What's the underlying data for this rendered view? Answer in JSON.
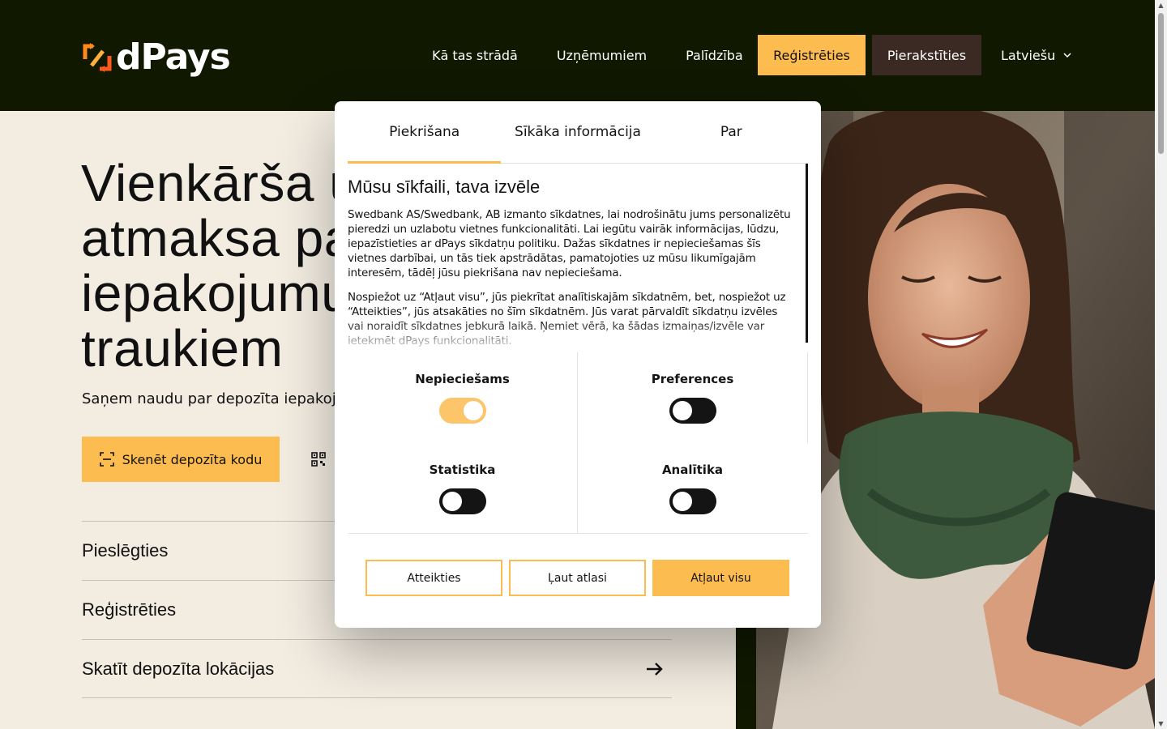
{
  "header": {
    "logo_text": "dPays",
    "nav": [
      "Kā tas strādā",
      "Uzņēmumiem",
      "Palīdzība"
    ],
    "register_label": "Reģistrēties",
    "login_label": "Pierakstīties",
    "language": "Latviešu"
  },
  "hero": {
    "title": "Vienkārša u\natmaksa pa\niepakojumu\ntraukiem",
    "subtitle": "Saņem naudu par depozīta iepakoju",
    "scan_button": "Skenēt depozīta kodu",
    "links": [
      "Pieslēgties",
      "Reģistrēties",
      "Skatīt depozīta lokācijas"
    ]
  },
  "modal": {
    "tabs": [
      "Piekrišana",
      "Sīkāka informācija",
      "Par"
    ],
    "active_tab": 0,
    "heading": "Mūsu sīkfaili, tava izvēle",
    "paragraph1": "Swedbank AS/Swedbank, AB izmanto sīkdatnes, lai nodrošinātu jums personalizētu pieredzi un uzlabotu vietnes funkcionalitāti. Lai iegūtu vairāk informācijas, lūdzu, iepazīstieties ar dPays sīkdatņu politiku. Dažas sīkdatnes ir nepieciešamas šīs vietnes darbībai, un tās tiek apstrādātas, pamatojoties uz mūsu likumīgajām interesēm, tādēļ jūsu piekrišana nav nepieciešama.",
    "paragraph2": "Nospiežot uz “Atļaut visu”, jūs piekrītat analītiskajām sīkdatnēm, bet, nospiežot uz “Atteikties”, jūs atsakāties no šīm sīkdatnēm. Jūs varat pārvaldīt sīkdatņu izvēles vai noraidīt sīkdatnes jebkurā laikā. Ņemiet vērā, ka šādas izmaiņas/izvēle var ietekmēt dPays funkcionalitāti.",
    "toggles": [
      {
        "label": "Nepieciešams",
        "on": true
      },
      {
        "label": "Preferences",
        "on": false
      },
      {
        "label": "Statistika",
        "on": false
      },
      {
        "label": "Analītika",
        "on": false
      }
    ],
    "buttons": {
      "decline": "Atteikties",
      "allow_selected": "Ļaut atlasi",
      "allow_all": "Atļaut visu"
    }
  },
  "colors": {
    "accent": "#fdbc4f",
    "header_bg": "#101800",
    "page_bg": "#f2ece1",
    "login_bg": "#3b2a23"
  }
}
